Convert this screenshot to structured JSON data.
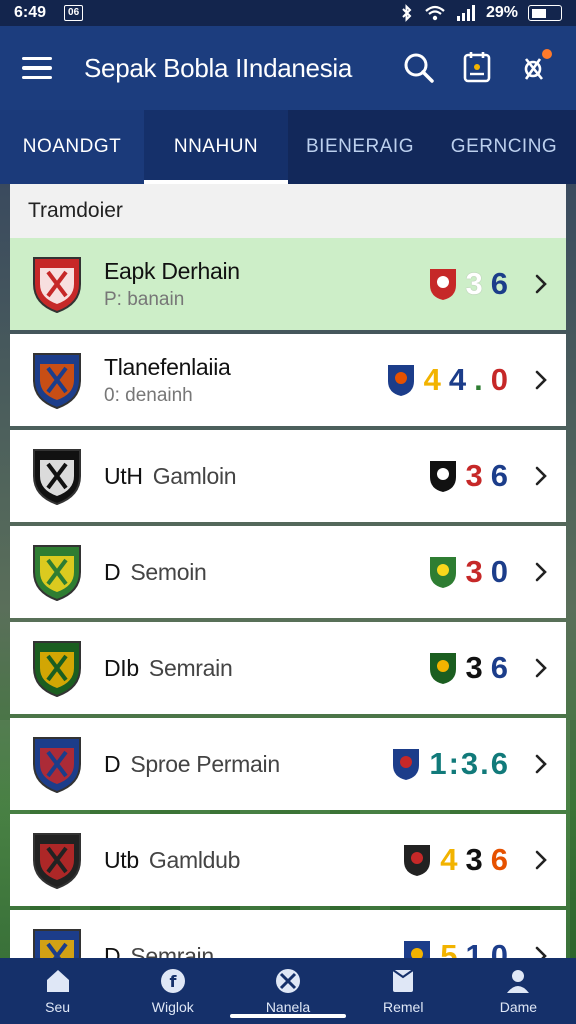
{
  "status_bar": {
    "time": "6:49",
    "battery": "29%",
    "sb_box": "06"
  },
  "app_bar": {
    "title": "Sepak Bobla IIndanesia"
  },
  "tabs": [
    {
      "label": "NOANDGT"
    },
    {
      "label": "NNAHUN"
    },
    {
      "label": "BIENERAIG"
    },
    {
      "label": "GERNCING"
    }
  ],
  "list": {
    "header": "Tramdoier",
    "rows": [
      {
        "name": "Eapk Derhain",
        "sub": "P: banain",
        "score_parts": [
          "3",
          "6"
        ],
        "score_colors": [
          "#ffffff",
          "#1c3d8a"
        ],
        "crest_color": "#c62828",
        "crest_accent": "#ffffff"
      },
      {
        "name": "Tlanefenlaiia",
        "sub": "0: denainh",
        "score_parts": [
          "4",
          "4",
          ".",
          "0"
        ],
        "score_colors": [
          "#f2b300",
          "#1c3d8a",
          "#2e7d32",
          "#c62828"
        ],
        "crest_color": "#1c3d8a",
        "crest_accent": "#e65100"
      },
      {
        "name": "UtH",
        "name2": "Gamloin",
        "sub": "",
        "score_parts": [
          "3",
          "6"
        ],
        "score_colors": [
          "#c62828",
          "#1c3d8a"
        ],
        "crest_color": "#111111",
        "crest_accent": "#ffffff"
      },
      {
        "name": "D",
        "name2": "Semoin",
        "sub": "",
        "score_parts": [
          "3",
          "0"
        ],
        "score_colors": [
          "#c62828",
          "#1c3d8a"
        ],
        "crest_color": "#2e7d32",
        "crest_accent": "#f9d71c"
      },
      {
        "name": "DIb",
        "name2": "Semrain",
        "sub": "",
        "score_parts": [
          "3",
          "6"
        ],
        "score_colors": [
          "#111111",
          "#1c3d8a"
        ],
        "crest_color": "#1b5e20",
        "crest_accent": "#f2b300"
      },
      {
        "name": "D",
        "name2": "Sproe Permain",
        "sub": "",
        "score_parts": [
          "1:3.6"
        ],
        "score_colors": [
          "#117a7a"
        ],
        "crest_color": "#1c3d8a",
        "crest_accent": "#c62828"
      },
      {
        "name": "Utb",
        "name2": "Gamldub",
        "sub": "",
        "score_parts": [
          "4",
          "3",
          "6"
        ],
        "score_colors": [
          "#f2b300",
          "#111111",
          "#e65100"
        ],
        "crest_color": "#222222",
        "crest_accent": "#c62828"
      },
      {
        "name": "D",
        "name2": "Semrain",
        "sub": "",
        "score_parts": [
          "5",
          "1",
          "0"
        ],
        "score_colors": [
          "#f2b300",
          "#1c3d8a",
          "#1c3d8a"
        ],
        "crest_color": "#1c3d8a",
        "crest_accent": "#f2b300"
      }
    ]
  },
  "bottom_nav": [
    {
      "label": "Seu",
      "icon": "home-icon"
    },
    {
      "label": "Wiglok",
      "icon": "info-icon"
    },
    {
      "label": "Nanela",
      "icon": "soccer-icon"
    },
    {
      "label": "Remel",
      "icon": "flag-icon"
    },
    {
      "label": "Dame",
      "icon": "person-icon"
    }
  ]
}
